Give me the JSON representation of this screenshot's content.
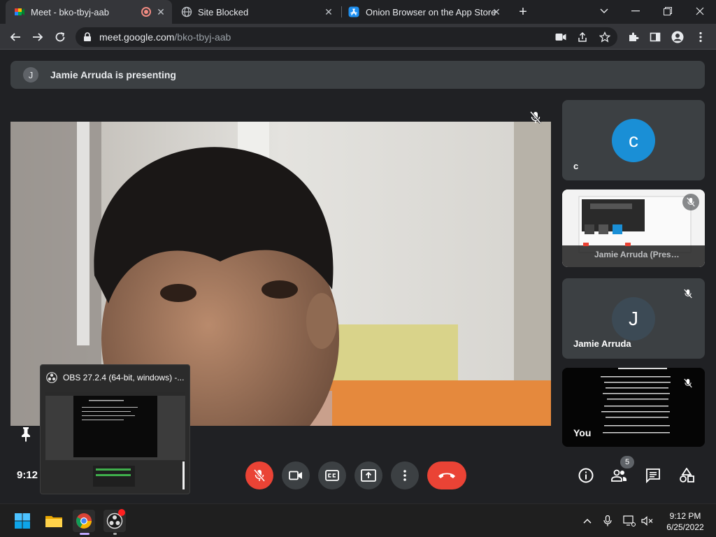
{
  "browser": {
    "tabs": [
      {
        "title": "Meet - bko-tbyj-aab",
        "icon": "google-meet-icon",
        "active": true,
        "recording": true
      },
      {
        "title": "Site Blocked",
        "icon": "globe-icon",
        "active": false
      },
      {
        "title": "Onion Browser on the App Store",
        "icon": "app-store-icon",
        "active": false
      }
    ],
    "url_host": "meet.google.com",
    "url_path": "/bko-tbyj-aab"
  },
  "meet": {
    "banner_initial": "J",
    "banner_text": "Jamie Arruda is presenting",
    "clock": "9:12",
    "participants_count": "5",
    "tiles": [
      {
        "initial": "c",
        "name": "c",
        "color": "#1a8fd6"
      },
      {
        "name": "Jamie Arruda (Pres…"
      },
      {
        "initial": "J",
        "name": "Jamie Arruda",
        "color": "#3c4a55"
      },
      {
        "name": "You"
      }
    ]
  },
  "obs": {
    "title": "OBS 27.2.4 (64-bit, windows) -..."
  },
  "taskbar": {
    "time": "9:12 PM",
    "date": "6/25/2022"
  },
  "colors": {
    "red": "#ea4335",
    "control_gray": "#3c4043",
    "bg": "#202124"
  }
}
